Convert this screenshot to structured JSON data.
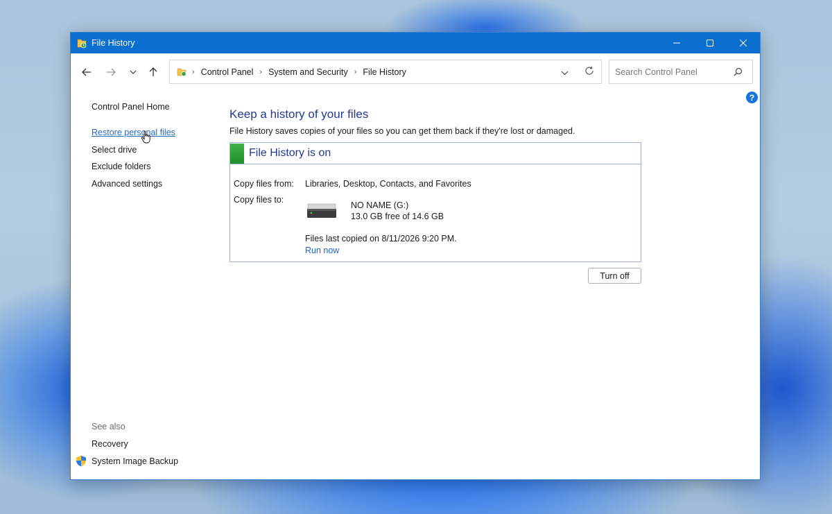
{
  "window": {
    "title": "File History",
    "minimize_icon": "minimize-icon",
    "maximize_icon": "maximize-icon",
    "close_icon": "close-icon"
  },
  "navbar": {
    "breadcrumbs": [
      "Control Panel",
      "System and Security",
      "File History"
    ],
    "search_placeholder": "Search Control Panel"
  },
  "sidebar": {
    "items": [
      {
        "label": "Control Panel Home"
      },
      {
        "label": "Restore personal files"
      },
      {
        "label": "Select drive"
      },
      {
        "label": "Exclude folders"
      },
      {
        "label": "Advanced settings"
      }
    ],
    "see_also_label": "See also",
    "see_also": [
      {
        "label": "Recovery"
      },
      {
        "label": "System Image Backup"
      }
    ]
  },
  "main": {
    "heading": "Keep a history of your files",
    "description": "File History saves copies of your files so you can get them back if they're lost or damaged.",
    "status_title": "File History is on",
    "copy_from_label": "Copy files from:",
    "copy_from_value": "Libraries, Desktop, Contacts, and Favorites",
    "copy_to_label": "Copy files to:",
    "drive_name": "NO NAME (G:)",
    "drive_space": "13.0 GB free of 14.6 GB",
    "last_copied": "Files last copied on 8/11/2026 9:20 PM.",
    "run_now": "Run now",
    "turn_off": "Turn off",
    "help": "?"
  },
  "colors": {
    "titlebar": "#0a6fcf",
    "heading": "#1f3a93",
    "link": "#1a66c6",
    "status_green": "#2aa035"
  }
}
